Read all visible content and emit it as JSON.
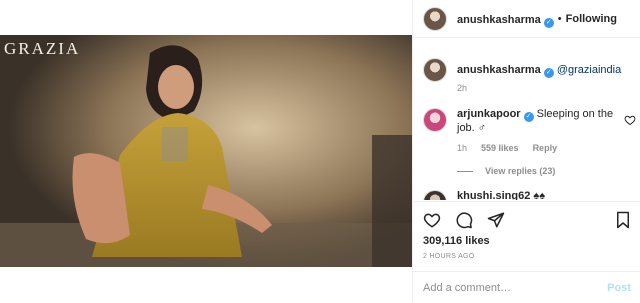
{
  "media": {
    "brand": "GRAZIA"
  },
  "header": {
    "username": "anushkasharma",
    "dot": "•",
    "following": "Following"
  },
  "caption": {
    "username": "anushkasharma",
    "mention": "@graziaindia",
    "time": "2h"
  },
  "comment": {
    "username": "arjunkapoor",
    "text": "Sleeping on the job. ♂",
    "time": "1h",
    "likes": "559 likes",
    "reply": "Reply",
    "view_replies": "View replies (23)"
  },
  "next_comment": {
    "username": "khushi.sing62",
    "text": "♠♠"
  },
  "stats": {
    "likes": "309,116 likes",
    "ago": "2 HOURS AGO"
  },
  "add_comment": {
    "placeholder": "Add a comment…",
    "post_label": "Post"
  },
  "colors": {
    "link": "#00376b",
    "verified": "#3897f0",
    "muted": "#8e8e8e",
    "post_disabled": "#b2dffc"
  }
}
